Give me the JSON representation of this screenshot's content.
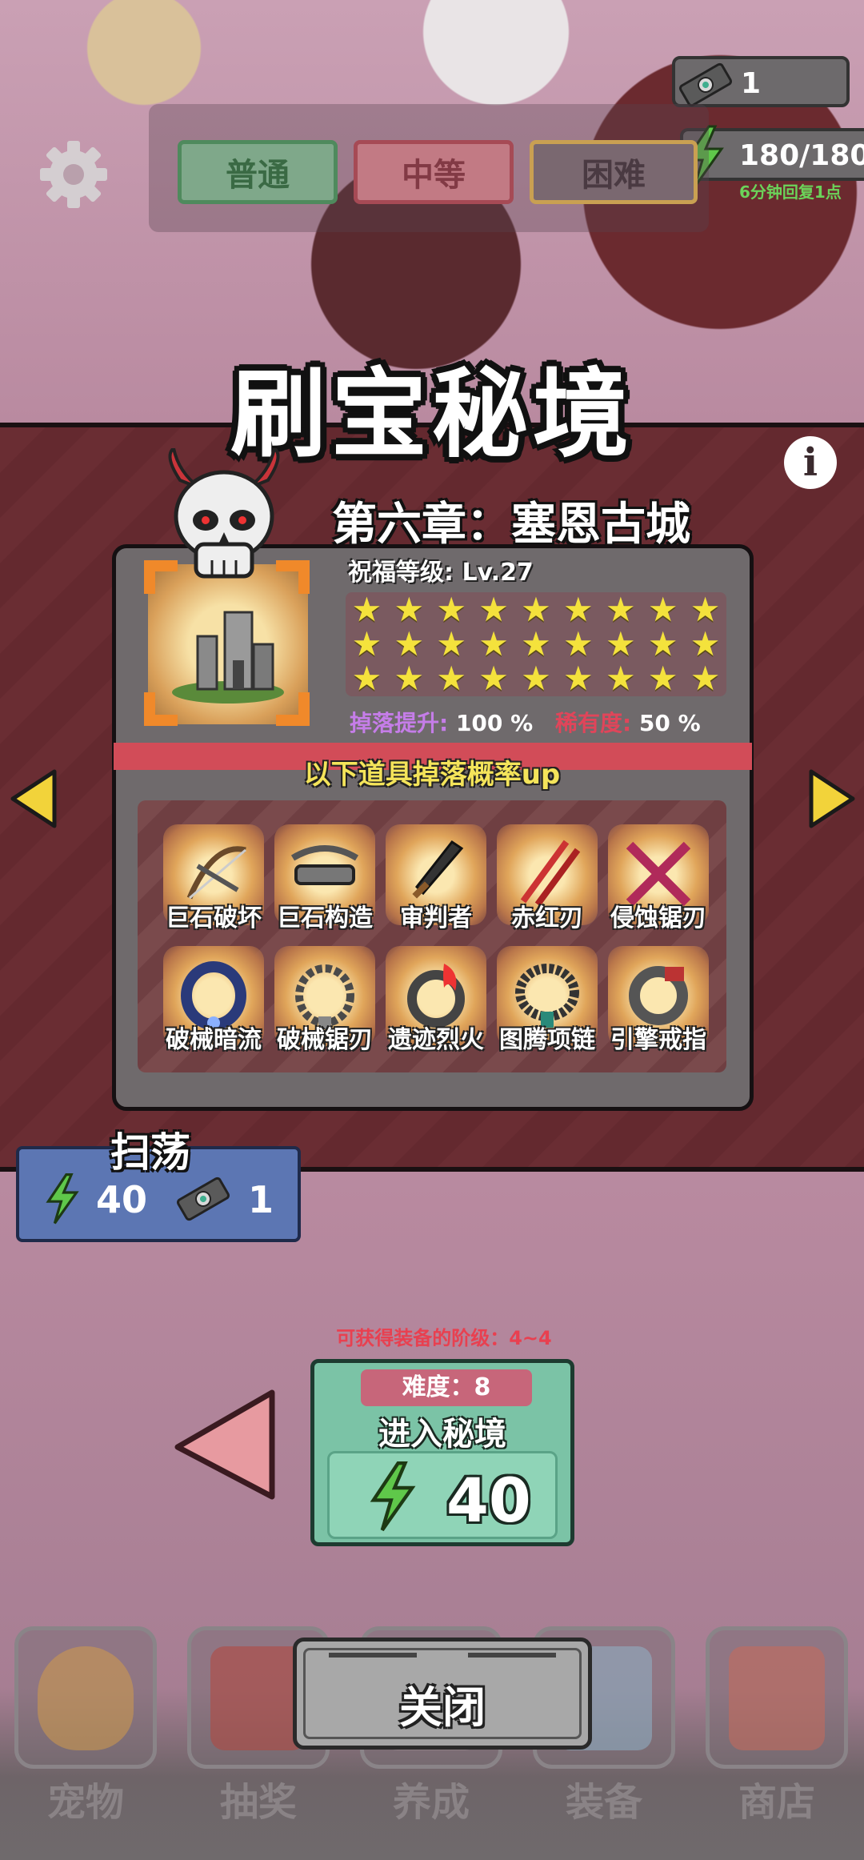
{
  "hud": {
    "tickets": "1",
    "energy": "180/180",
    "energy_regen": "6分钟回复1点"
  },
  "difficulty_tabs": [
    "普通",
    "中等",
    "困难"
  ],
  "title": "刷宝秘境",
  "info_label": "i",
  "chapter": "第六章：塞恩古城",
  "blessing": "祝福等级: Lv.27",
  "stars": 27,
  "drop_boost": {
    "label": "掉落提升:",
    "value": "100 %"
  },
  "rarity": {
    "label": "稀有度:",
    "value": "50 %"
  },
  "up_banner": "以下道具掉落概率up",
  "items": [
    {
      "name": "巨石破坏",
      "icon": "crossbow-icon"
    },
    {
      "name": "巨石构造",
      "icon": "heavy-crossbow-icon"
    },
    {
      "name": "审判者",
      "icon": "sword-icon"
    },
    {
      "name": "赤红刃",
      "icon": "twin-blades-icon"
    },
    {
      "name": "侵蚀锯刃",
      "icon": "crossed-saws-icon"
    },
    {
      "name": "破械暗流",
      "icon": "necklace-icon"
    },
    {
      "name": "破械锯刃",
      "icon": "chain-necklace-icon"
    },
    {
      "name": "遗迹烈火",
      "icon": "flame-ring-icon"
    },
    {
      "name": "图腾项链",
      "icon": "totem-necklace-icon"
    },
    {
      "name": "引擎戒指",
      "icon": "engine-ring-icon"
    }
  ],
  "sweep": {
    "title": "扫荡",
    "energy_cost": "40",
    "ticket_cost": "1"
  },
  "tier_text": "可获得装备的阶级：4~4",
  "enter": {
    "difficulty": "难度：8",
    "label": "进入秘境",
    "cost": "40"
  },
  "nav": [
    "宠物",
    "抽奖",
    "养成",
    "装备",
    "商店"
  ],
  "close_label": "关闭",
  "colors": {
    "accent": "#7bc3a6",
    "panel": "#6a2d33",
    "star": "#f4e23c",
    "energy": "#6bd35a"
  }
}
